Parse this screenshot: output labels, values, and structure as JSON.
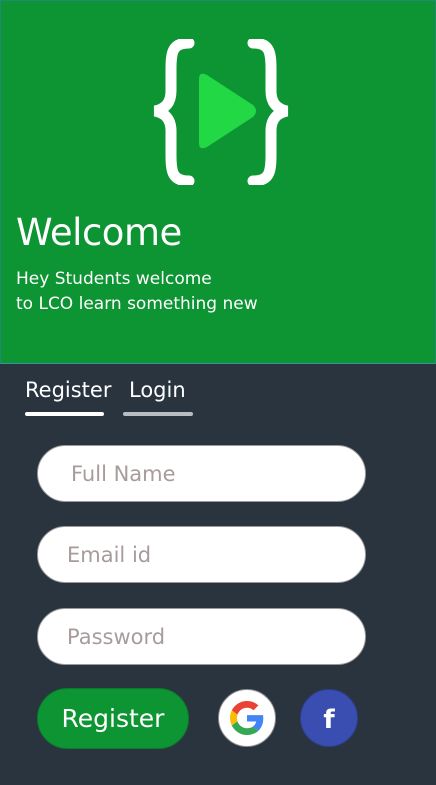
{
  "header": {
    "title": "Welcome",
    "subtitle_line1": "Hey Students welcome",
    "subtitle_line2": "to LCO learn something new",
    "logo_icon": "braces-play-icon"
  },
  "tabs": [
    {
      "label": "Register",
      "active": true
    },
    {
      "label": "Login",
      "active": false
    }
  ],
  "form": {
    "full_name_placeholder": "Full Name",
    "full_name_value": "",
    "email_placeholder": "Email id",
    "email_value": "",
    "password_placeholder": "Password",
    "password_value": ""
  },
  "actions": {
    "register_label": "Register",
    "google_icon": "google-icon",
    "facebook_icon": "facebook-icon",
    "facebook_glyph": "f"
  },
  "colors": {
    "header_green": "#0d9433",
    "logo_green": "#22d845",
    "panel_dark": "#2a343f",
    "facebook_blue": "#3a4db0"
  }
}
